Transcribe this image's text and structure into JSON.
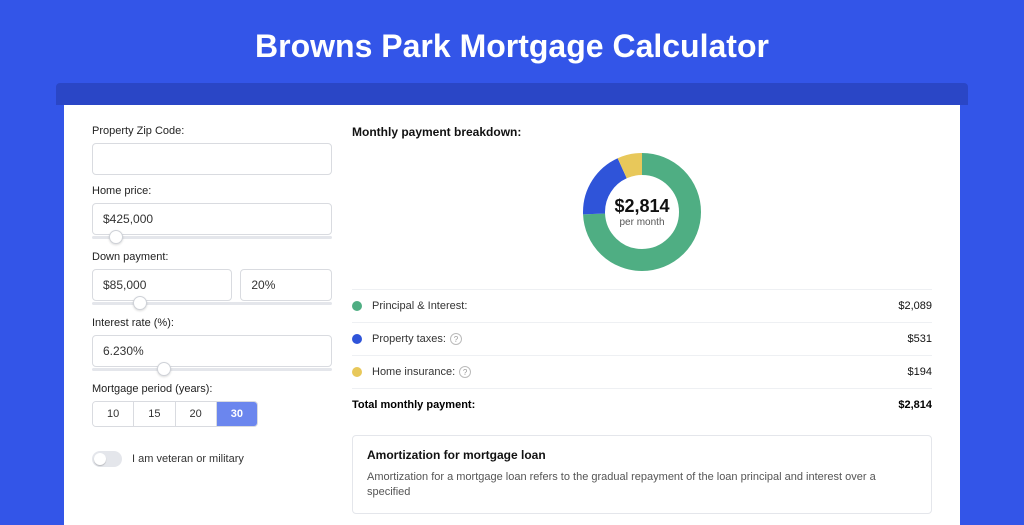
{
  "title": "Browns Park Mortgage Calculator",
  "form": {
    "zip_label": "Property Zip Code:",
    "zip_value": "",
    "home_price_label": "Home price:",
    "home_price_value": "$425,000",
    "down_payment_label": "Down payment:",
    "down_payment_value": "$85,000",
    "down_payment_pct": "20%",
    "interest_label": "Interest rate (%):",
    "interest_value": "6.230%",
    "period_label": "Mortgage period (years):",
    "periods": [
      "10",
      "15",
      "20",
      "30"
    ],
    "period_selected": "30",
    "veteran_label": "I am veteran or military"
  },
  "breakdown": {
    "title": "Monthly payment breakdown:",
    "center_value": "$2,814",
    "center_sub": "per month",
    "items": [
      {
        "label": "Principal & Interest:",
        "value": "$2,089",
        "color": "#4fae83"
      },
      {
        "label": "Property taxes:",
        "value": "$531",
        "color": "#2f54d9",
        "info": true
      },
      {
        "label": "Home insurance:",
        "value": "$194",
        "color": "#e8c85a",
        "info": true
      }
    ],
    "total_label": "Total monthly payment:",
    "total_value": "$2,814"
  },
  "amort": {
    "title": "Amortization for mortgage loan",
    "text": "Amortization for a mortgage loan refers to the gradual repayment of the loan principal and interest over a specified"
  },
  "chart_data": {
    "type": "pie",
    "title": "Monthly payment breakdown",
    "series": [
      {
        "name": "Principal & Interest",
        "value": 2089,
        "color": "#4fae83"
      },
      {
        "name": "Property taxes",
        "value": 531,
        "color": "#2f54d9"
      },
      {
        "name": "Home insurance",
        "value": 194,
        "color": "#e8c85a"
      }
    ],
    "total": 2814
  }
}
